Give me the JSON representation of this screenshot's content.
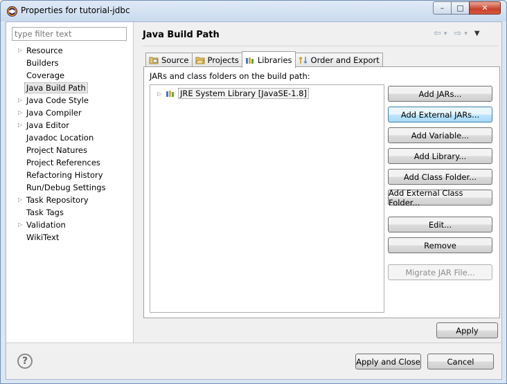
{
  "window": {
    "title": "Properties for tutorial-jdbc",
    "minimize": "–",
    "maximize": "□",
    "close": "✕"
  },
  "filter": {
    "placeholder": "type filter text",
    "value": ""
  },
  "tree": [
    {
      "label": "Resource",
      "expandable": true
    },
    {
      "label": "Builders",
      "expandable": false
    },
    {
      "label": "Coverage",
      "expandable": false
    },
    {
      "label": "Java Build Path",
      "expandable": false,
      "selected": true
    },
    {
      "label": "Java Code Style",
      "expandable": true
    },
    {
      "label": "Java Compiler",
      "expandable": true
    },
    {
      "label": "Java Editor",
      "expandable": true
    },
    {
      "label": "Javadoc Location",
      "expandable": false
    },
    {
      "label": "Project Natures",
      "expandable": false
    },
    {
      "label": "Project References",
      "expandable": false
    },
    {
      "label": "Refactoring History",
      "expandable": false
    },
    {
      "label": "Run/Debug Settings",
      "expandable": false
    },
    {
      "label": "Task Repository",
      "expandable": true
    },
    {
      "label": "Task Tags",
      "expandable": false
    },
    {
      "label": "Validation",
      "expandable": true
    },
    {
      "label": "WikiText",
      "expandable": false
    }
  ],
  "page": {
    "title": "Java Build Path",
    "nav": {
      "back": "⇦",
      "back_menu": "▾",
      "forward": "⇨",
      "forward_menu": "▾",
      "view_menu": "▼"
    }
  },
  "tabs": [
    {
      "label": "Source",
      "icon": "source-folder-icon",
      "active": false
    },
    {
      "label": "Projects",
      "icon": "projects-folder-icon",
      "active": false
    },
    {
      "label": "Libraries",
      "icon": "libraries-icon",
      "active": true
    },
    {
      "label": "Order and Export",
      "icon": "order-export-icon",
      "active": false
    }
  ],
  "libraries": {
    "heading": "JARs and class folders on the build path:",
    "items": [
      {
        "label": "JRE System Library [JavaSE-1.8]",
        "icon": "library-icon"
      }
    ]
  },
  "buttons": {
    "add_jars": "Add JARs...",
    "add_external_jars": "Add External JARs...",
    "add_variable": "Add Variable...",
    "add_library": "Add Library...",
    "add_class_folder": "Add Class Folder...",
    "add_external_class_folder": "Add External Class Folder...",
    "edit": "Edit...",
    "remove": "Remove",
    "migrate_jar": "Migrate JAR File...",
    "apply": "Apply",
    "apply_and_close": "Apply and Close",
    "cancel": "Cancel"
  },
  "help": "?"
}
